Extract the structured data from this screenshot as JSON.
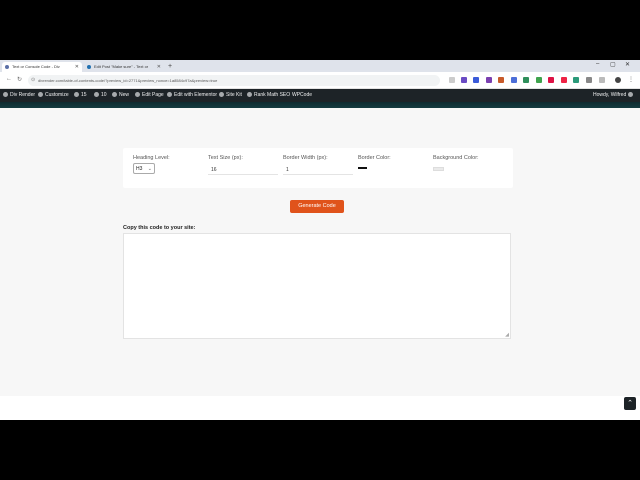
{
  "browser": {
    "tabs": [
      {
        "title": "Text or Console Code - Div"
      },
      {
        "title": "Edit Post \"Make sure\" - Text or"
      }
    ],
    "new_tab_icon": "plus-icon",
    "url": "divrender.com/table-of-contents-code/?preview_id=2771&preview_nonce=1a8584c97a&preview=true"
  },
  "adminbar": {
    "items": [
      {
        "label": "Div Render"
      },
      {
        "label": "Customize"
      },
      {
        "label": "15"
      },
      {
        "label": "10"
      },
      {
        "label": "New"
      },
      {
        "label": "Edit Page"
      },
      {
        "label": "Edit with Elementor"
      },
      {
        "label": "Site Kit"
      },
      {
        "label": "Rank Math SEO"
      },
      {
        "label": "WPCode"
      }
    ],
    "greeting": "Howdy, Wilfred"
  },
  "form": {
    "heading_level": {
      "label": "Heading Level:",
      "value": "H3"
    },
    "text_size": {
      "label": "Text Size (px):",
      "value": "16"
    },
    "border_width": {
      "label": "Border Width (px):",
      "value": "1"
    },
    "border_color": {
      "label": "Border Color:",
      "value": "#111111"
    },
    "background_color": {
      "label": "Background Color:",
      "value": "#eaeaea"
    }
  },
  "generate_button": "Generate Code",
  "copy_label": "Copy this code to your site:",
  "code_output": "",
  "colors": {
    "accent": "#e0531b",
    "adminbar": "#1d2327"
  }
}
